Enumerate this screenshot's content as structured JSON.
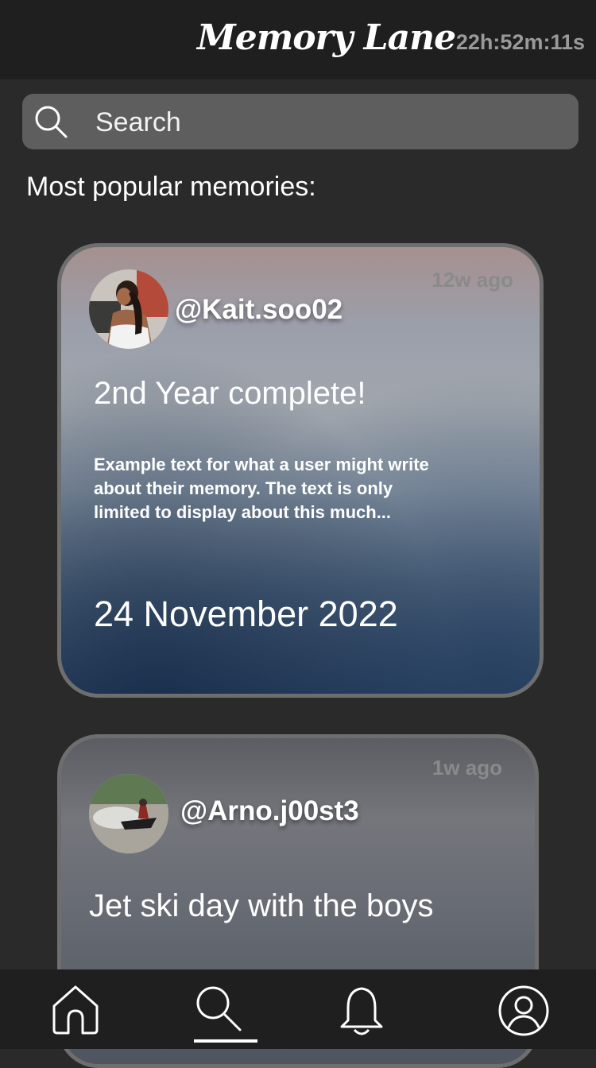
{
  "header": {
    "title": "Memory Lane",
    "countdown": "22h:52m:11s"
  },
  "search": {
    "placeholder": "Search",
    "icon": "search-icon"
  },
  "section_title": "Most popular memories:",
  "memories": [
    {
      "username": "@Kait.soo02",
      "time_ago": "12w ago",
      "title": "2nd Year complete!",
      "excerpt": "Example text for what a user might write about their memory. The text is only limited to display about this much...",
      "date": "24 November 2022"
    },
    {
      "username": "@Arno.j00st3",
      "time_ago": "1w ago",
      "title": "Jet ski day with the boys"
    }
  ],
  "nav": {
    "items": [
      "home-icon",
      "search-icon",
      "bell-icon",
      "profile-icon"
    ],
    "active": "search-icon"
  },
  "colors": {
    "background": "#2a2a2a",
    "bar": "#1f1f1f",
    "search_field": "#5e5e5e",
    "muted_text": "#9a9a9a"
  }
}
